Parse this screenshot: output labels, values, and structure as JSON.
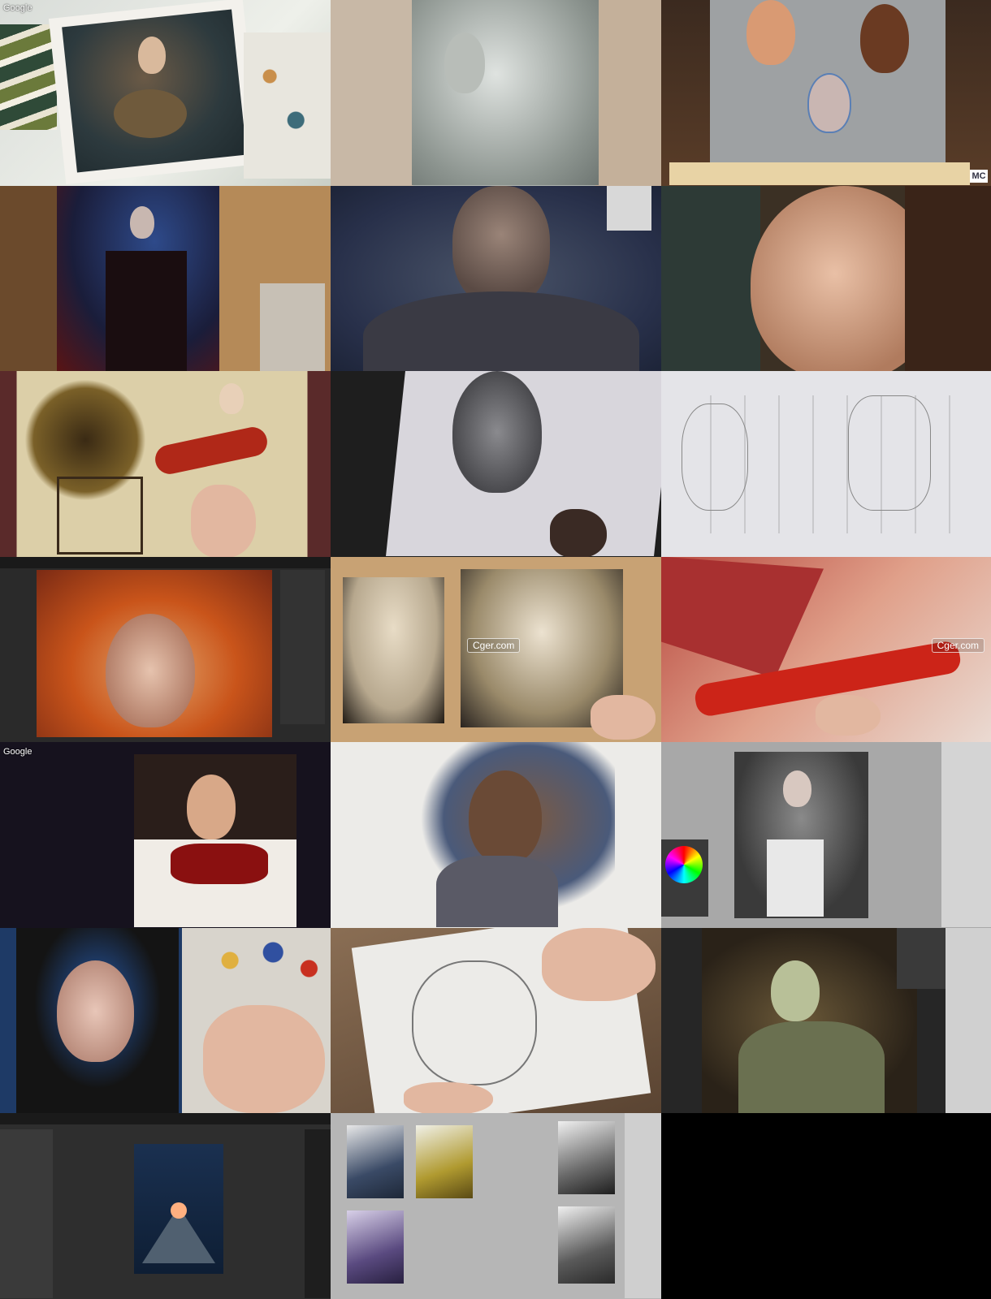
{
  "watermarks": {
    "google_1": "Google",
    "google_2": "Google",
    "cger_1": "Cger.com",
    "cger_2": "Cger.com",
    "mc_logo": "MC"
  },
  "colors": {
    "background": "#000000",
    "photoshop_panel": "#2b2b2b",
    "photoshop_gray_canvas": "#a8a8a8"
  },
  "tiles": [
    {
      "id": "toad-portrait-painting"
    },
    {
      "id": "charcoal-woman-sketch"
    },
    {
      "id": "three-head-studies"
    },
    {
      "id": "skeleton-dress-painting-easel"
    },
    {
      "id": "creature-digital-painting"
    },
    {
      "id": "girl-portrait-closeup"
    },
    {
      "id": "guitar-woman-ink-painting"
    },
    {
      "id": "pencil-portrait-drawing"
    },
    {
      "id": "superhero-line-sketches"
    },
    {
      "id": "red-hair-digital-portrait"
    },
    {
      "id": "edgar-poe-study"
    },
    {
      "id": "demon-guitar-painting"
    },
    {
      "id": "woman-oil-sketch"
    },
    {
      "id": "man-oil-portrait"
    },
    {
      "id": "dark-lady-digital-painting"
    },
    {
      "id": "blue-woman-oil-portrait"
    },
    {
      "id": "creature-pencil-drawing"
    },
    {
      "id": "armored-knight-painting"
    },
    {
      "id": "pyramid-sci-fi-painting"
    },
    {
      "id": "value-thumbnails-study"
    },
    {
      "id": "empty-black"
    }
  ]
}
